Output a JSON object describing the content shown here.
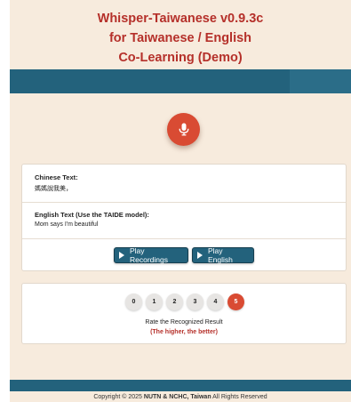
{
  "header": {
    "title_line1": "Whisper-Taiwanese v0.9.3c",
    "title_line2": "for Taiwanese / English",
    "title_line3": "Co-Learning (Demo)"
  },
  "mic": {
    "icon": "microphone-icon"
  },
  "transcript": {
    "chinese_label": "Chinese Text:",
    "chinese_value": "媽媽說我美，",
    "english_label": "English Text (Use the TAIDE model):",
    "english_value": "Mom says I'm beautiful"
  },
  "buttons": {
    "play_recordings": "Play Recordings",
    "play_english": "Play English"
  },
  "rating": {
    "options": [
      "0",
      "1",
      "2",
      "3",
      "4",
      "5"
    ],
    "selected": "5",
    "caption": "Rate the Recognized Result",
    "hint": "(The higher, the better)"
  },
  "footer": {
    "prefix": "Copyright © 2025 ",
    "org": "NUTN & NCHC, Taiwan",
    "suffix": " All Rights Reserved"
  },
  "colors": {
    "background": "#f7ebdd",
    "title_red": "#b5302a",
    "bar_teal": "#23627c",
    "accent_red": "#d94b33"
  }
}
